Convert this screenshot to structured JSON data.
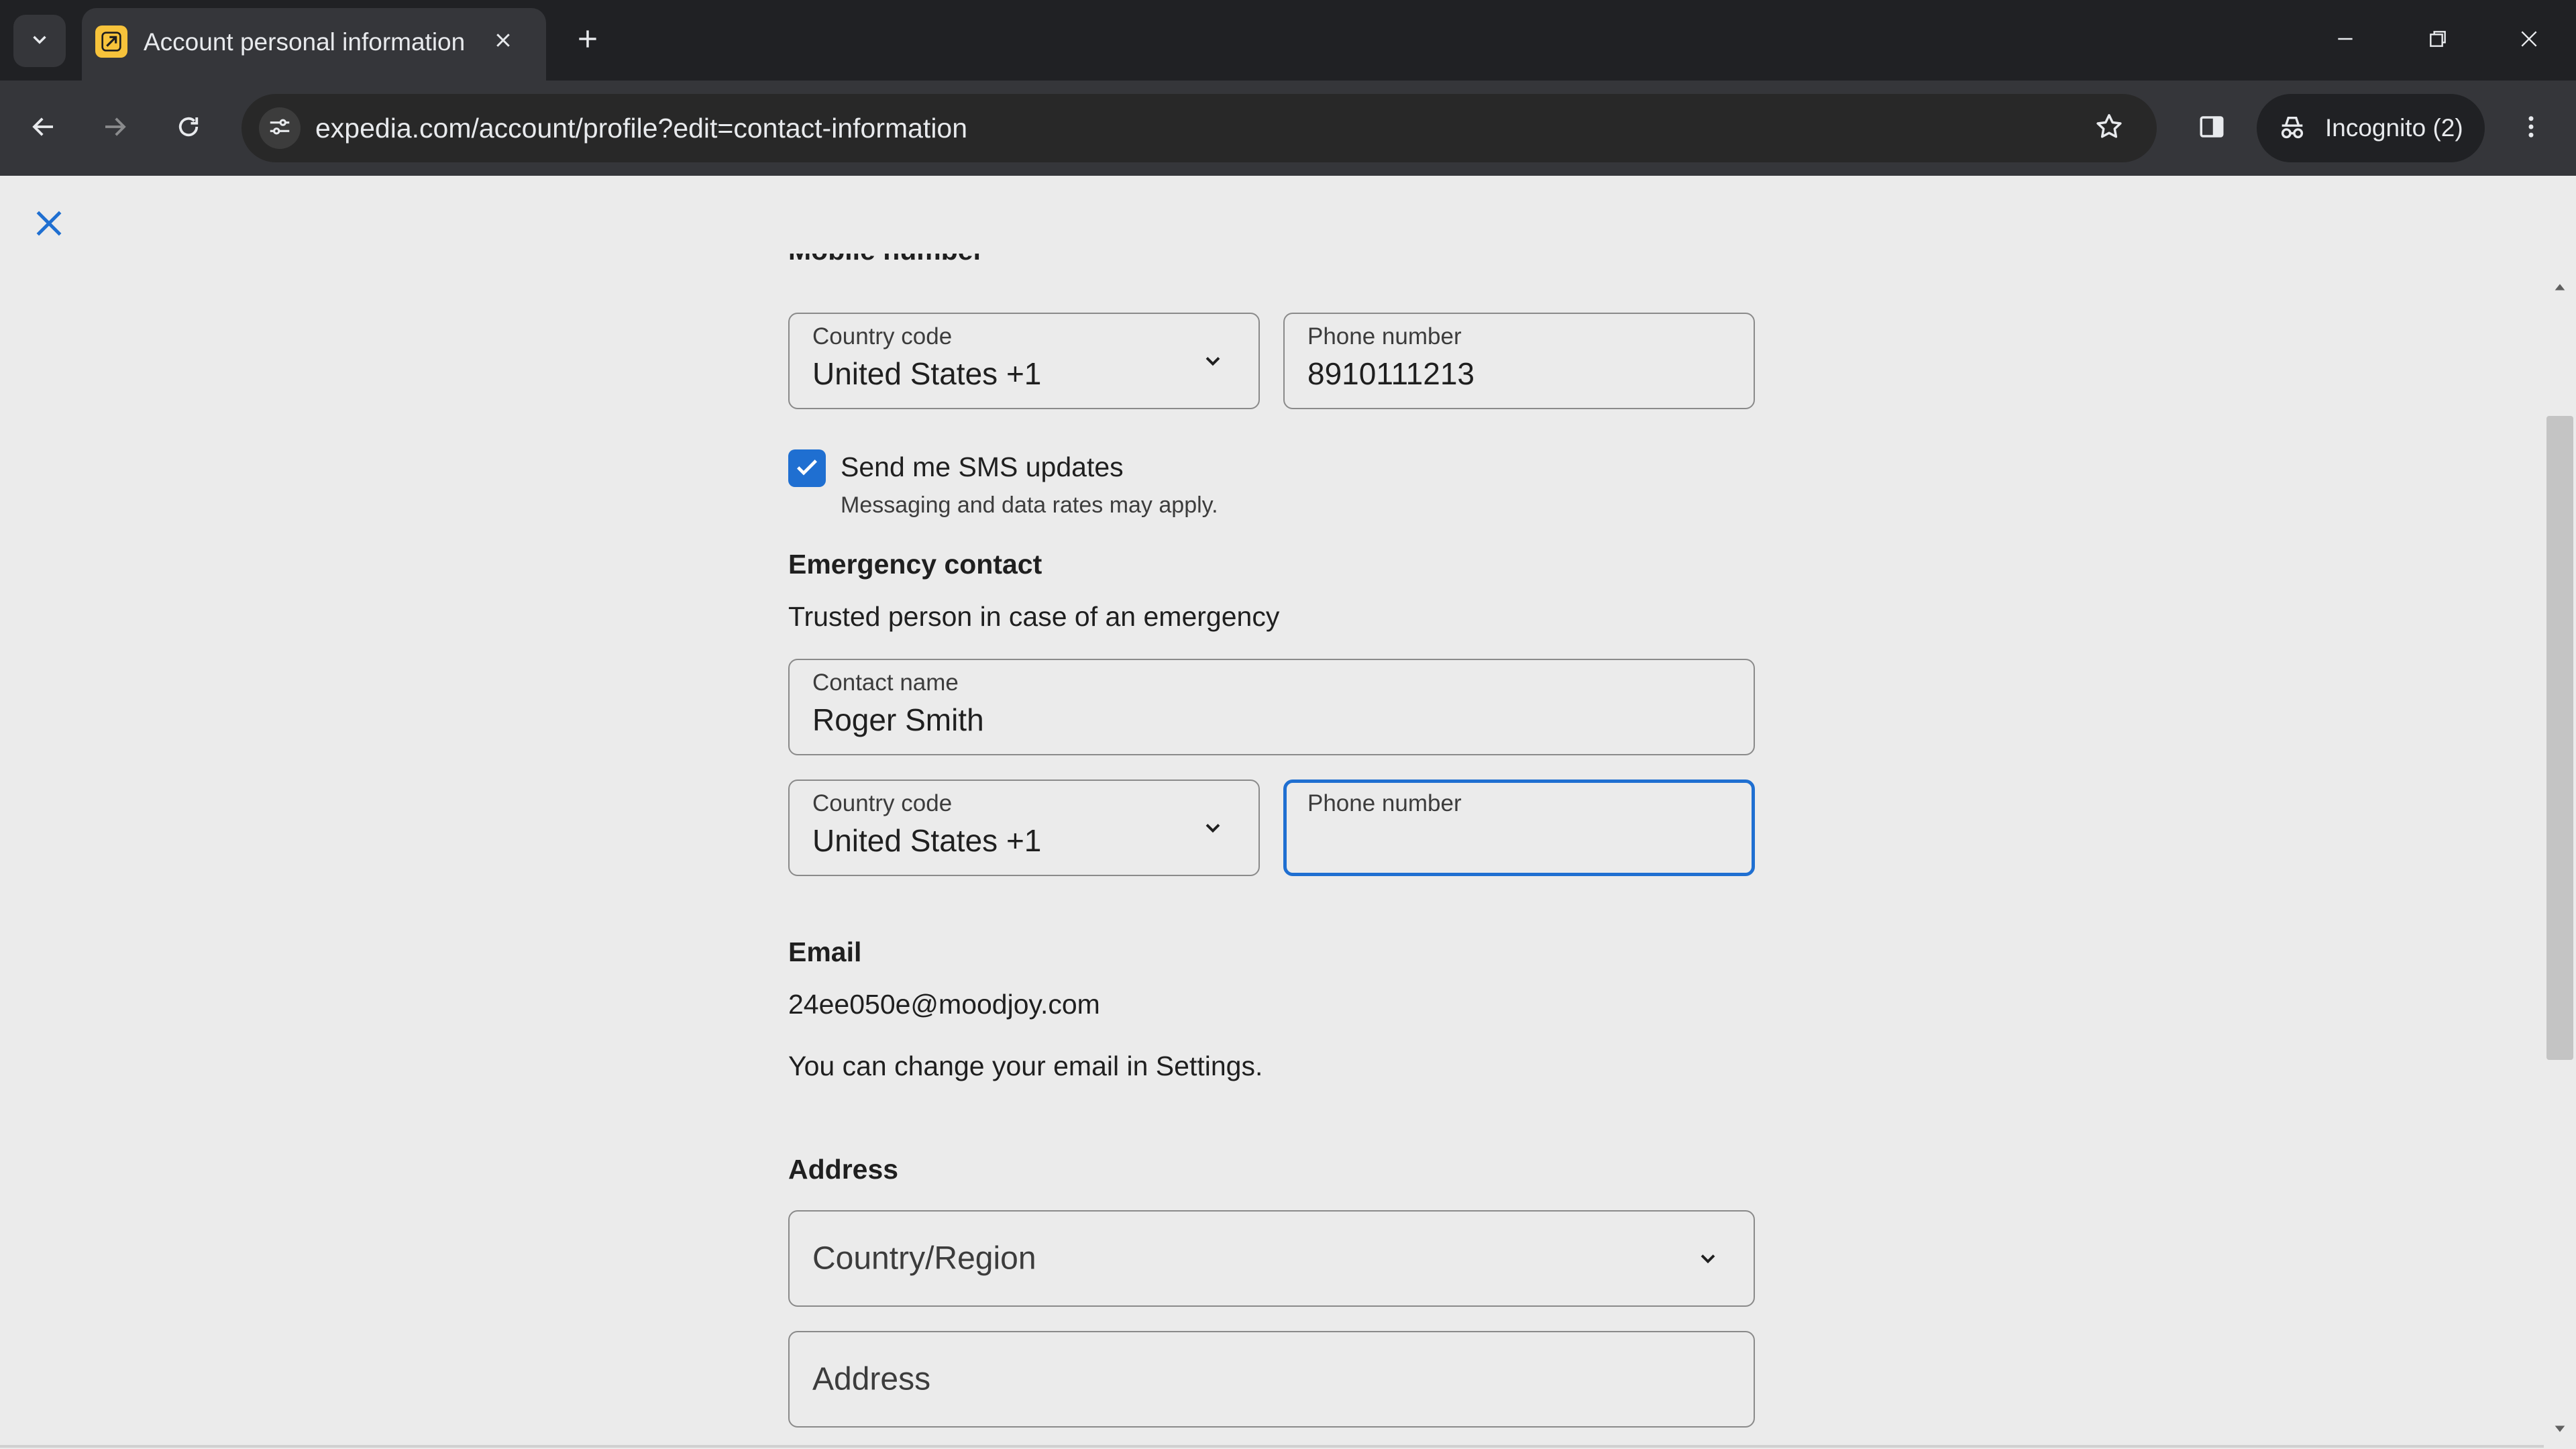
{
  "browser": {
    "tab": {
      "title": "Account personal information",
      "favicon": "expedia-icon",
      "favicon_color": "#f7c33b"
    },
    "url": "expedia.com/account/profile?edit=contact-information",
    "profile_label": "Incognito (2)"
  },
  "page": {
    "mobile_heading": "Mobile number",
    "mobile": {
      "country_code_label": "Country code",
      "country_code_value": "United States +1",
      "phone_label": "Phone number",
      "phone_value": "8910111213"
    },
    "sms": {
      "checked": true,
      "label": "Send me SMS updates",
      "note": "Messaging and data rates may apply."
    },
    "emergency": {
      "heading": "Emergency contact",
      "description": "Trusted person in case of an emergency",
      "contact_name_label": "Contact name",
      "contact_name_value": "Roger Smith",
      "country_code_label": "Country code",
      "country_code_value": "United States +1",
      "phone_label": "Phone number",
      "phone_value": ""
    },
    "email": {
      "heading": "Email",
      "value": "24ee050e@moodjoy.com",
      "note": "You can change your email in Settings."
    },
    "address": {
      "heading": "Address",
      "country_placeholder": "Country/Region",
      "address_placeholder": "Address"
    }
  },
  "colors": {
    "accent": "#1f6fd1",
    "page_background": "#ebebeb",
    "chrome_dark": "#202124",
    "toolbar": "#35363a"
  }
}
